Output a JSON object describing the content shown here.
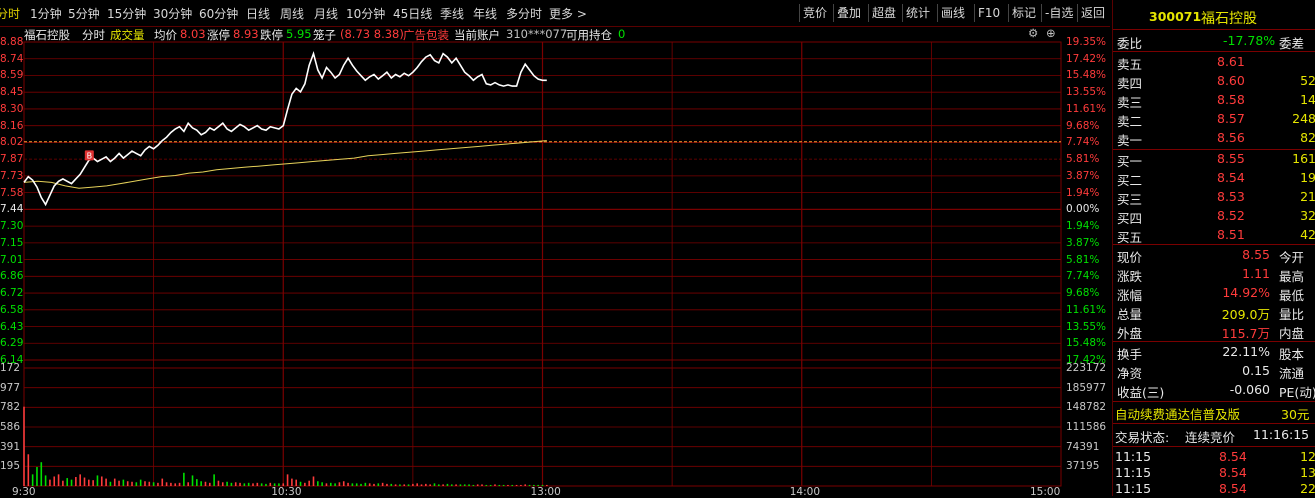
{
  "tabs": [
    "分时",
    "1分钟",
    "5分钟",
    "15分钟",
    "30分钟",
    "60分钟",
    "日线",
    "周线",
    "月线",
    "10分钟",
    "45日线",
    "季线",
    "年线",
    "多分时",
    "更多 >"
  ],
  "right_buttons": [
    "竞价",
    "叠加",
    "超盘",
    "统计",
    "画线",
    "F10",
    "标记",
    "-自选",
    "返回"
  ],
  "info": {
    "name": "福石控股",
    "mode": "分时",
    "volume_label": "成交量",
    "avg_label": "均价",
    "avg_value": "8.03",
    "limit_up_label": "涨停",
    "limit_up_value": "8.93",
    "limit_down_label": "跌停",
    "limit_down_value": "5.95",
    "bid_label": "笼子",
    "bid_value": "(8.73 8.38)",
    "ad_label": "广告包装",
    "account_label": "当前账户",
    "account_value": "310***077",
    "position_label": "可用持仓",
    "position_value": "0",
    "trade_marker": "B"
  },
  "price_axis": {
    "left_labels": [
      "8.88",
      "8.74",
      "8.59",
      "8.45",
      "8.30",
      "8.16",
      "8.02",
      "7.87",
      "7.73",
      "7.58",
      "7.44",
      "7.30",
      "7.15",
      "7.01",
      "6.86",
      "6.72",
      "6.58",
      "6.43",
      "6.29",
      "6.14"
    ],
    "right_labels": [
      "19.35%",
      "17.42%",
      "15.48%",
      "13.55%",
      "11.61%",
      "9.68%",
      "7.74%",
      "5.81%",
      "3.87%",
      "1.94%",
      "0.00%",
      "1.94%",
      "3.87%",
      "5.81%",
      "7.74%",
      "9.68%",
      "11.61%",
      "13.55%",
      "15.48%",
      "17.42%"
    ],
    "prev_close": "7.44"
  },
  "volume_axis": {
    "left_labels": [
      "172",
      "977",
      "782",
      "586",
      "391",
      "195"
    ],
    "right_labels": [
      "223172",
      "185977",
      "148782",
      "111586",
      "74391",
      "37195"
    ]
  },
  "time_axis": [
    "9:30",
    "10:30",
    "13:00",
    "14:00",
    "15:00"
  ],
  "chart_data": {
    "type": "line",
    "x_unit": "minute index from 9:30",
    "price": [
      7.67,
      7.72,
      7.69,
      7.63,
      7.54,
      7.48,
      7.56,
      7.64,
      7.68,
      7.7,
      7.68,
      7.66,
      7.7,
      7.74,
      7.8,
      7.86,
      7.88,
      7.85,
      7.87,
      7.89,
      7.85,
      7.88,
      7.92,
      7.88,
      7.91,
      7.94,
      7.92,
      7.9,
      7.95,
      7.98,
      7.96,
      7.99,
      8.03,
      8.06,
      8.1,
      8.13,
      8.15,
      8.11,
      8.18,
      8.14,
      8.12,
      8.08,
      8.1,
      8.14,
      8.12,
      8.15,
      8.18,
      8.13,
      8.11,
      8.14,
      8.17,
      8.15,
      8.12,
      8.14,
      8.16,
      8.13,
      8.12,
      8.15,
      8.14,
      8.13,
      8.16,
      8.3,
      8.43,
      8.48,
      8.45,
      8.52,
      8.68,
      8.78,
      8.64,
      8.57,
      8.66,
      8.62,
      8.57,
      8.6,
      8.68,
      8.74,
      8.68,
      8.63,
      8.59,
      8.55,
      8.58,
      8.6,
      8.56,
      8.59,
      8.62,
      8.57,
      8.6,
      8.58,
      8.61,
      8.59,
      8.62,
      8.66,
      8.71,
      8.75,
      8.77,
      8.72,
      8.7,
      8.78,
      8.75,
      8.7,
      8.74,
      8.68,
      8.62,
      8.59,
      8.55,
      8.58,
      8.6,
      8.52,
      8.51,
      8.53,
      8.51,
      8.5,
      8.51,
      8.5,
      8.5,
      8.62,
      8.69,
      8.64,
      8.59,
      8.56,
      8.55,
      8.55
    ],
    "avg_price": [
      7.67,
      7.68,
      7.67,
      7.64,
      7.62,
      7.63,
      7.64,
      7.66,
      7.68,
      7.7,
      7.72,
      7.73,
      7.75,
      7.76,
      7.78,
      7.79,
      7.8,
      7.81,
      7.82,
      7.83,
      7.84,
      7.85,
      7.86,
      7.87,
      7.88,
      7.9,
      7.91,
      7.92,
      7.93,
      7.94,
      7.95,
      7.96,
      7.97,
      7.98,
      7.99,
      8.0,
      8.01,
      8.02,
      8.03
    ],
    "volume": [
      150000,
      60000,
      22000,
      36000,
      45000,
      20000,
      12000,
      18000,
      22000,
      10000,
      15000,
      12000,
      17000,
      22000,
      16000,
      12000,
      11000,
      20000,
      18000,
      14000,
      8000,
      14000,
      10000,
      12000,
      9000,
      8000,
      7000,
      12000,
      9000,
      8000,
      7000,
      6000,
      14000,
      7000,
      6000,
      5000,
      6000,
      25000,
      7000,
      20000,
      13000,
      9000,
      8000,
      6000,
      22000,
      10000,
      7000,
      8000,
      6000,
      7000,
      6000,
      5000,
      6000,
      5000,
      6000,
      5000,
      4000,
      6000,
      5000,
      5000,
      5000,
      22000,
      14000,
      12000,
      8000,
      6000,
      10000,
      18000,
      9000,
      7000,
      5000,
      6000,
      5000,
      7000,
      9000,
      6000,
      5000,
      5000,
      4000,
      6000,
      5000,
      4000,
      5000,
      6000,
      4000,
      4000,
      3000,
      3000,
      3000,
      3000,
      4000,
      5000,
      3000,
      4000,
      3000,
      5000,
      3000,
      3000,
      4000,
      3000,
      3000,
      3000,
      3000,
      3000,
      2000,
      3000,
      3000,
      2000,
      2000,
      3000,
      2000,
      2000,
      2000,
      2000,
      2000,
      2000,
      3000,
      2000,
      2000,
      2000,
      2000,
      2000
    ],
    "ylim": [
      6.14,
      8.88
    ],
    "vol_ylim": [
      0,
      223172
    ],
    "prev_close": 7.44
  },
  "panel": {
    "code": "300071",
    "name": "福石控股",
    "weibi_label": "委比",
    "weibi_value": "-17.78%",
    "weicha_label": "委差",
    "asks": [
      {
        "label": "卖五",
        "price": "8.61",
        "vol": ""
      },
      {
        "label": "卖四",
        "price": "8.60",
        "vol": "52"
      },
      {
        "label": "卖三",
        "price": "8.58",
        "vol": "14"
      },
      {
        "label": "卖二",
        "price": "8.57",
        "vol": "248"
      },
      {
        "label": "卖一",
        "price": "8.56",
        "vol": "82"
      }
    ],
    "bids": [
      {
        "label": "买一",
        "price": "8.55",
        "vol": "161"
      },
      {
        "label": "买二",
        "price": "8.54",
        "vol": "19"
      },
      {
        "label": "买三",
        "price": "8.53",
        "vol": "21"
      },
      {
        "label": "买四",
        "price": "8.52",
        "vol": "32"
      },
      {
        "label": "买五",
        "price": "8.51",
        "vol": "42"
      }
    ],
    "stats": [
      {
        "l": "现价",
        "v": "8.55",
        "r": "今开",
        "vc": "red"
      },
      {
        "l": "涨跌",
        "v": "1.11",
        "r": "最高",
        "vc": "red"
      },
      {
        "l": "涨幅",
        "v": "14.92%",
        "r": "最低",
        "vc": "red"
      },
      {
        "l": "总量",
        "v": "209.0万",
        "r": "量比",
        "vc": "yellow"
      },
      {
        "l": "外盘",
        "v": "115.7万",
        "r": "内盘",
        "vc": "red"
      }
    ],
    "stats2": [
      {
        "l": "换手",
        "v": "22.11%",
        "r": "股本"
      },
      {
        "l": "净资",
        "v": "0.15",
        "r": "流通"
      },
      {
        "l": "收益(三)",
        "v": "-0.060",
        "r": "PE(动)"
      }
    ],
    "ad_text": "自动续费通达信普及版",
    "ad_price": "30元",
    "trade_status_label": "交易状态:",
    "trade_status": "连续竞价",
    "trade_time": "11:16:15",
    "ticks": [
      {
        "t": "11:15",
        "p": "8.54",
        "v": "12"
      },
      {
        "t": "11:15",
        "p": "8.54",
        "v": "13"
      },
      {
        "t": "11:15",
        "p": "8.54",
        "v": "22"
      }
    ]
  },
  "colors": {
    "up": "#ff3b3b",
    "down": "#00e000",
    "grid": "#7a0000",
    "price_line": "#ffffff",
    "avg_line": "#e6d25a",
    "highlight": "#e6e600"
  }
}
